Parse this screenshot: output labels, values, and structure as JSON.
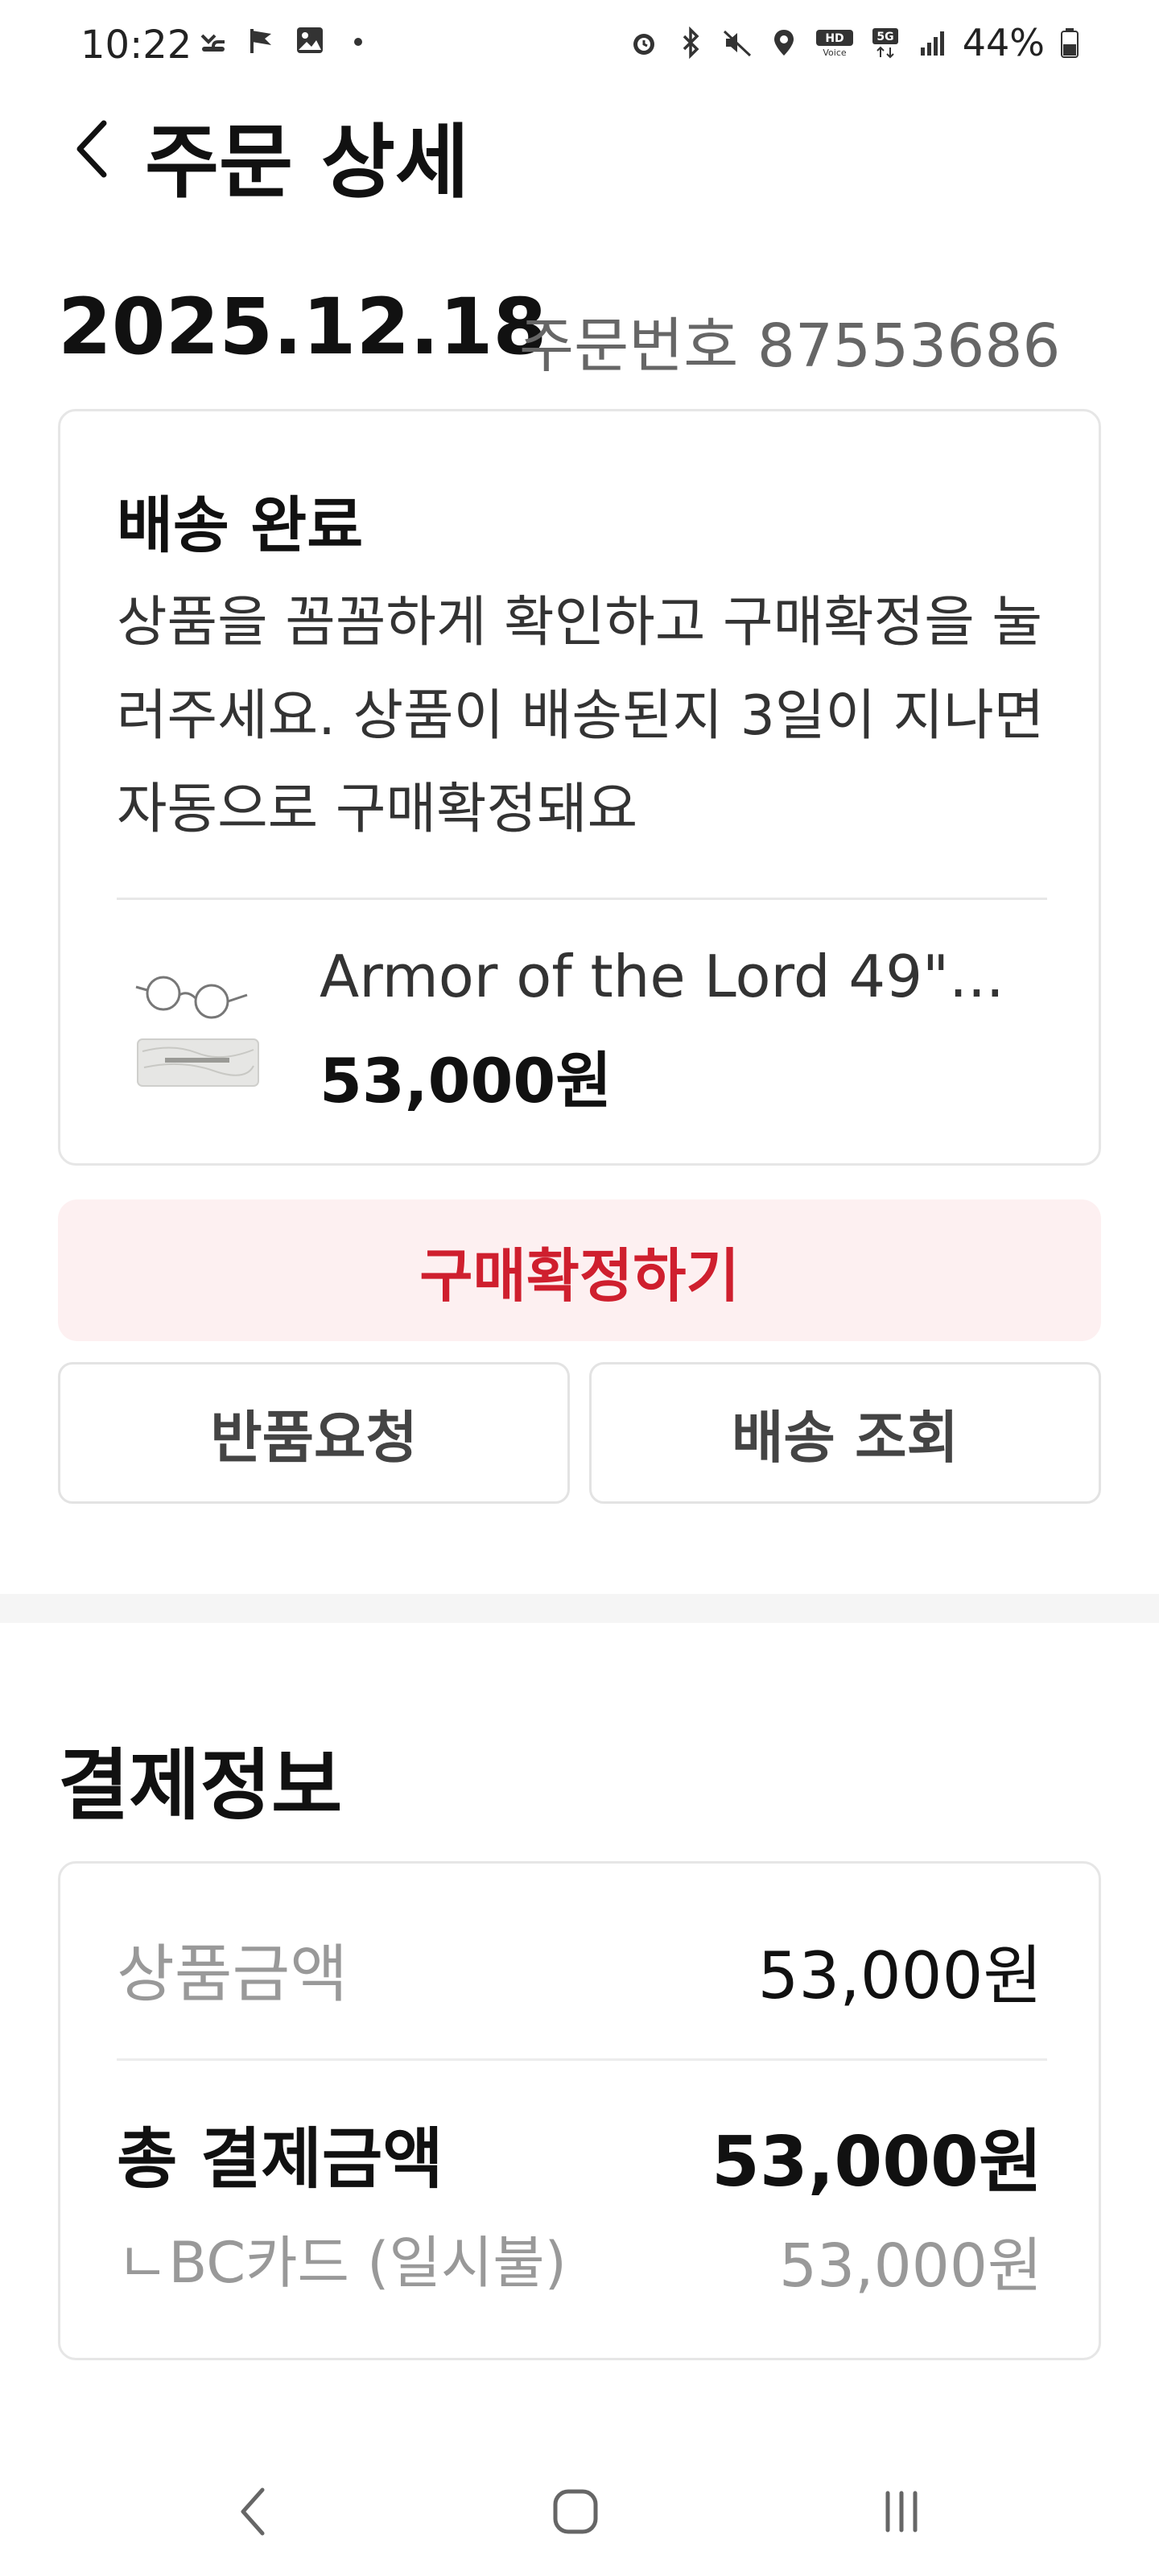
{
  "status_bar": {
    "time": "10:22",
    "left_icons": [
      "missed-call-icon",
      "flag-icon",
      "image-icon",
      "dot-icon"
    ],
    "right_icons": [
      "alarm-icon",
      "bluetooth-icon",
      "mute-icon",
      "location-icon",
      "hd-voice-icon",
      "5g-icon",
      "signal-icon",
      "battery-icon"
    ],
    "battery": "44%"
  },
  "header": {
    "title": "주문 상세"
  },
  "order": {
    "date": "2025.12.18",
    "number_label": "주문번호 87553686"
  },
  "delivery": {
    "status": "배송 완료",
    "description": "상품을 꼼꼼하게 확인하고 구매확정을 눌러주세요. 상품이 배송된지 3일이 지나면 자동으로 구매확정돼요"
  },
  "product": {
    "name": "Armor of the Lord 49\"...",
    "price": "53,000원"
  },
  "actions": {
    "confirm": "구매확정하기",
    "return": "반품요청",
    "track": "배송 조회"
  },
  "payment": {
    "title": "결제정보",
    "subtotal_label": "상품금액",
    "subtotal_value": "53,000원",
    "total_label": "총 결제금액",
    "total_value": "53,000원",
    "method_label": "ㄴBC카드 (일시불)",
    "method_value": "53,000원"
  },
  "colors": {
    "accent": "#cf1f2e",
    "accent_bg": "#fdf0f1",
    "muted": "#999999"
  }
}
